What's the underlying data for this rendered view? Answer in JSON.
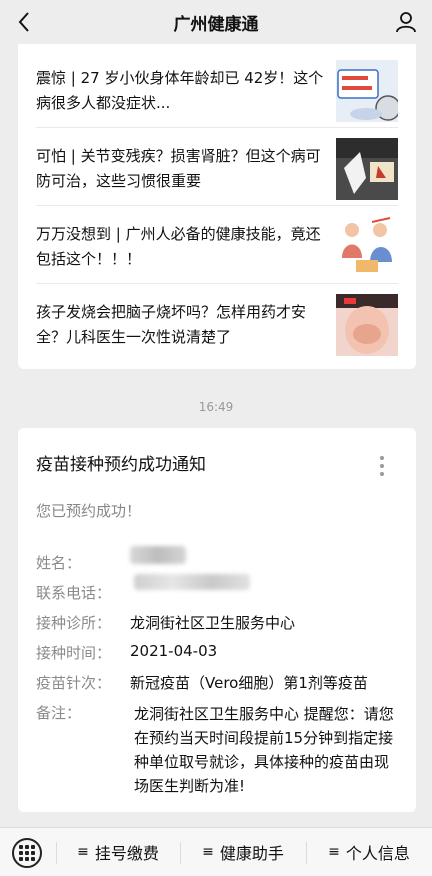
{
  "header": {
    "title": "广州健康通"
  },
  "news": [
    {
      "text": "震惊 | 27 岁小伙身体年龄却已 42岁！这个病很多人都没症状..."
    },
    {
      "text": "可怕 | 关节变残疾？损害肾脏？但这个病可防可治，这些习惯很重要"
    },
    {
      "text": "万万没想到 | 广州人必备的健康技能，竟还包括这个！！！"
    },
    {
      "text": "孩子发烧会把脑子烧坏吗？怎样用药才安全？儿科医生一次性说清楚了"
    }
  ],
  "timestamp": "16:49",
  "notice": {
    "title": "疫苗接种预约成功通知",
    "subtitle": "您已预约成功！",
    "labels": {
      "name": "姓名：",
      "phone": "联系电话：",
      "clinic": "接种诊所：",
      "time": "接种时间：",
      "dose": "疫苗针次：",
      "remark": "备注："
    },
    "values": {
      "clinic": "龙洞街社区卫生服务中心",
      "time": "2021-04-03",
      "dose": "新冠疫苗（Vero细胞）第1剂等疫苗",
      "remark": "龙洞街社区卫生服务中心 提醒您：请您在预约当天时间段提前15分钟到指定接种单位取号就诊，具体接种的疫苗由现场医生判断为准!"
    }
  },
  "bottom_menu": {
    "items": [
      {
        "label": "挂号缴费"
      },
      {
        "label": "健康助手"
      },
      {
        "label": "个人信息"
      }
    ],
    "menu_icon": "≡"
  },
  "icons": {
    "back": "chevron-left-icon",
    "profile": "person-icon",
    "more": "vertical-dots-icon",
    "keyboard": "keyboard-icon"
  }
}
